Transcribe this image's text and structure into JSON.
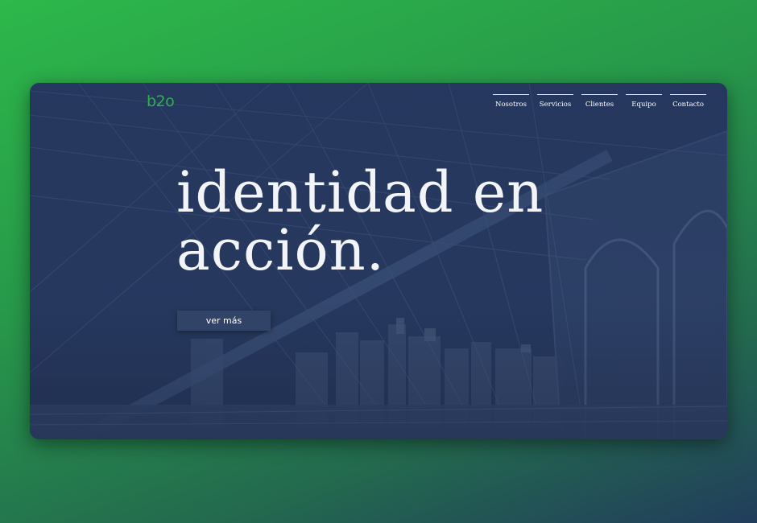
{
  "brand": {
    "logo_text": "b2o",
    "logo_color": "#2fae4e"
  },
  "nav": {
    "items": [
      {
        "label": "Nosotros"
      },
      {
        "label": "Servicios"
      },
      {
        "label": "Clientes"
      },
      {
        "label": "Equipo"
      },
      {
        "label": "Contacto"
      }
    ]
  },
  "hero": {
    "headline_line1": "identidad en",
    "headline_line2": "acción.",
    "cta_label": "ver más",
    "background_image": "bridge-cables-city-skyline",
    "overlay_color": "#24365c"
  },
  "colors": {
    "page_gradient_start": "#2db84a",
    "page_gradient_end": "#213d5c",
    "text": "#ffffff"
  }
}
